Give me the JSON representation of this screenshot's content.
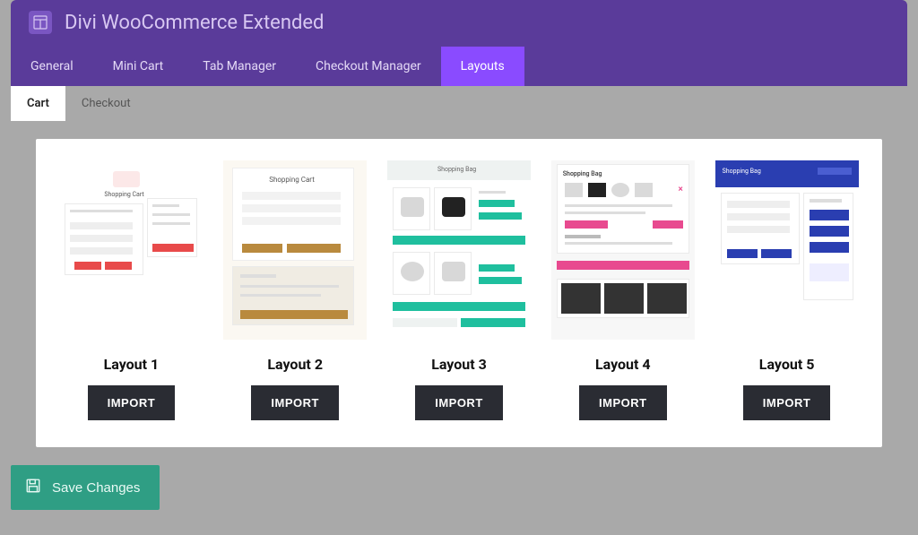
{
  "header": {
    "title": "Divi WooCommerce Extended"
  },
  "top_tabs": {
    "items": [
      {
        "label": "General"
      },
      {
        "label": "Mini Cart"
      },
      {
        "label": "Tab Manager"
      },
      {
        "label": "Checkout Manager"
      },
      {
        "label": "Layouts"
      }
    ],
    "active_index": 4
  },
  "sub_tabs": {
    "items": [
      {
        "label": "Cart"
      },
      {
        "label": "Checkout"
      }
    ],
    "active_index": 0
  },
  "layouts": [
    {
      "title": "Layout 1",
      "button": "IMPORT",
      "thumb_title": "Shopping Cart"
    },
    {
      "title": "Layout 2",
      "button": "IMPORT",
      "thumb_title": "Shopping Cart"
    },
    {
      "title": "Layout 3",
      "button": "IMPORT",
      "thumb_title": "Shopping Bag"
    },
    {
      "title": "Layout 4",
      "button": "IMPORT",
      "thumb_title": "Shopping Bag"
    },
    {
      "title": "Layout 5",
      "button": "IMPORT",
      "thumb_title": "Shopping Bag"
    }
  ],
  "save": {
    "label": "Save Changes"
  },
  "colors": {
    "purple": "#5a3b9a",
    "accent": "#8a4bff",
    "btn": "#2a2c33",
    "teal": "#2f9e84"
  }
}
